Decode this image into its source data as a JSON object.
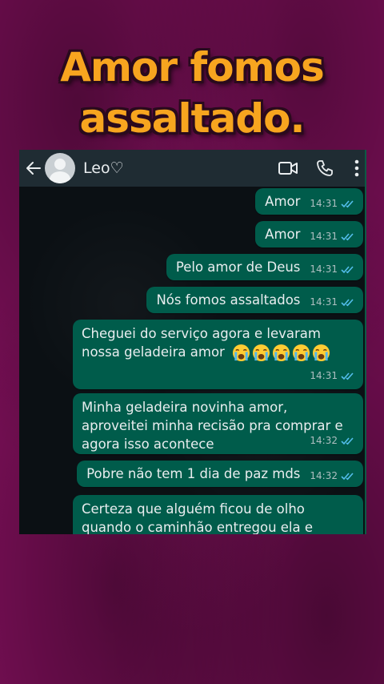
{
  "headline": {
    "line1": "Amor fomos",
    "line2": "assaltado."
  },
  "header": {
    "back_icon": "arrow-left-icon",
    "contact_name": "Leo♡",
    "icons": [
      "video-call-icon",
      "phone-call-icon",
      "more-vert-icon"
    ]
  },
  "messages": [
    {
      "text": "Amor",
      "time": "14:31",
      "status": "read"
    },
    {
      "text": "Amor",
      "time": "14:31",
      "status": "read"
    },
    {
      "text": "Pelo amor de Deus",
      "time": "14:31",
      "status": "read"
    },
    {
      "text": "Nós fomos assaltados",
      "time": "14:31",
      "status": "read"
    },
    {
      "text": "Cheguei do serviço agora e levaram nossa geladeira amor",
      "emoji": "😭😭😭😭😭",
      "time": "14:31",
      "status": "read"
    },
    {
      "text": "Minha geladeira novinha amor, aproveitei minha recisão pra comprar e agora isso acontece",
      "time": "14:32",
      "status": "read"
    },
    {
      "text": "Pobre não tem 1 dia de paz mds",
      "time": "14:32",
      "status": "read"
    },
    {
      "text": "Certeza que alguém ficou de olho quando o caminhão entregou ela e",
      "time": "",
      "status": ""
    }
  ],
  "colors": {
    "outgoing_bubble": "#005c4b",
    "header": "#1f2c33",
    "headline": "#f7a51f",
    "page_background": "#7a0f57",
    "read_ticks": "#53bdeb"
  }
}
